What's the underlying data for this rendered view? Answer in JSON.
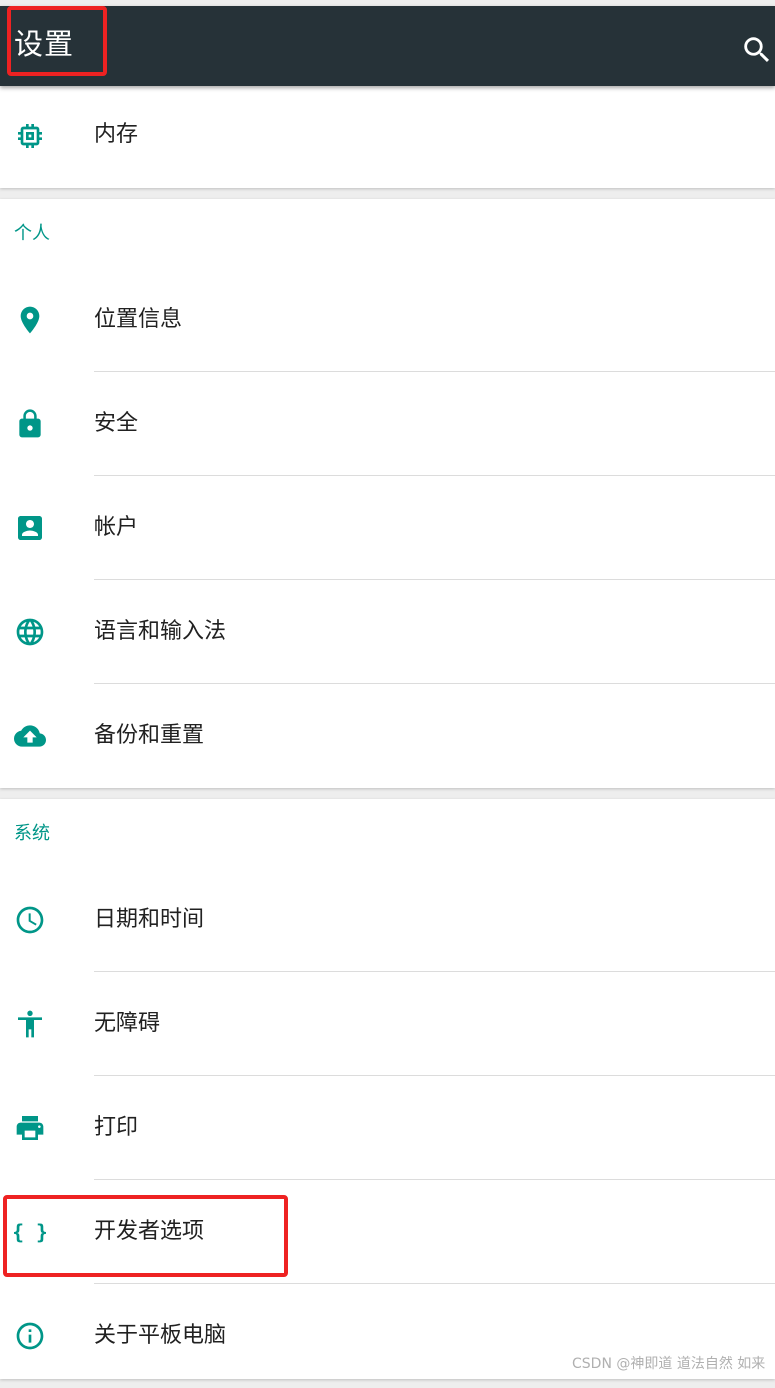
{
  "app_bar": {
    "title": "设置",
    "search_icon": "search-icon",
    "background": "#263238"
  },
  "accent_color": "#009688",
  "storage_card": {
    "items": [
      {
        "label": "内存",
        "icon": "memory-icon"
      }
    ]
  },
  "personal": {
    "header": "个人",
    "items": [
      {
        "label": "位置信息",
        "icon": "location-pin-icon"
      },
      {
        "label": "安全",
        "icon": "lock-icon"
      },
      {
        "label": "帐户",
        "icon": "account-box-icon"
      },
      {
        "label": "语言和输入法",
        "icon": "globe-icon"
      },
      {
        "label": "备份和重置",
        "icon": "cloud-upload-icon"
      }
    ]
  },
  "system": {
    "header": "系统",
    "items": [
      {
        "label": "日期和时间",
        "icon": "clock-icon"
      },
      {
        "label": "无障碍",
        "icon": "accessibility-icon"
      },
      {
        "label": "打印",
        "icon": "printer-icon"
      },
      {
        "label": "开发者选项",
        "icon": "developer-braces-icon"
      },
      {
        "label": "关于平板电脑",
        "icon": "info-icon"
      }
    ]
  },
  "watermark": "CSDN @神即道 道法自然 如来",
  "annotation_color": "#ee2222"
}
